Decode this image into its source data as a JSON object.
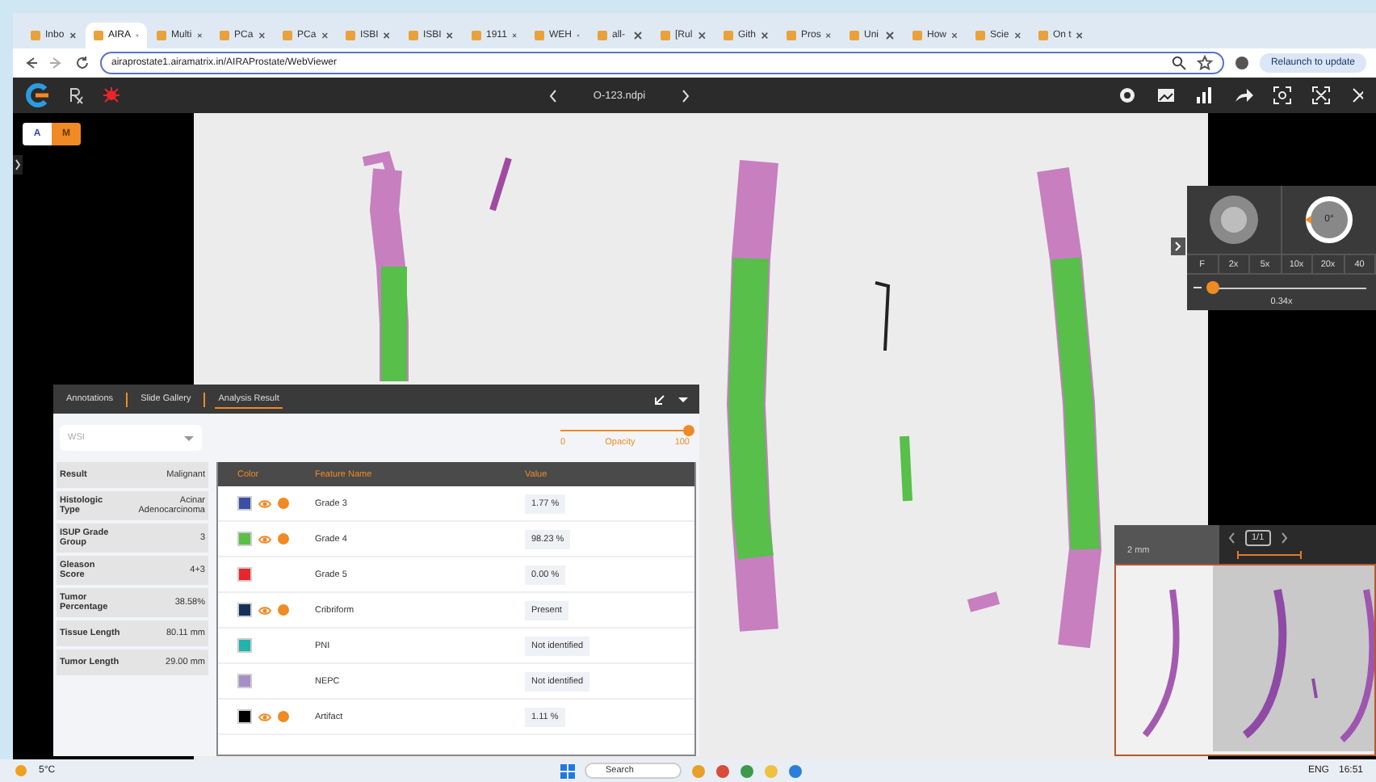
{
  "browser": {
    "tabs": [
      {
        "label": "Inbo",
        "selected": false
      },
      {
        "label": "AIRA",
        "selected": true
      },
      {
        "label": "Multi",
        "selected": false
      },
      {
        "label": "PCa",
        "selected": false
      },
      {
        "label": "PCa",
        "selected": false
      },
      {
        "label": "ISBI",
        "selected": false
      },
      {
        "label": "ISBI",
        "selected": false
      },
      {
        "label": "1911",
        "selected": false
      },
      {
        "label": "WEH",
        "selected": false
      },
      {
        "label": "all-",
        "selected": false
      },
      {
        "label": "[Rul",
        "selected": false
      },
      {
        "label": "Gith",
        "selected": false
      },
      {
        "label": "Pros",
        "selected": false
      },
      {
        "label": "Uni",
        "selected": false
      },
      {
        "label": "How",
        "selected": false
      },
      {
        "label": "Scie",
        "selected": false
      },
      {
        "label": "On t",
        "selected": false
      }
    ],
    "url": "airaprostate1.airamatrix.in/AIRAProstate/WebViewer",
    "update_button": "Relaunch to update"
  },
  "toolbar": {
    "file_name": "O-123.ndpi"
  },
  "mode_toggle": [
    {
      "label": "A",
      "selected": false
    },
    {
      "label": "M",
      "selected": true
    }
  ],
  "panel": {
    "tabs": [
      {
        "label": "Annotations",
        "selected": false
      },
      {
        "label": "Slide Gallery",
        "selected": false
      },
      {
        "label": "Analysis Result",
        "selected": true
      }
    ],
    "scope_select": {
      "value": "WSI"
    },
    "opacity": {
      "min": "0",
      "label": "Opacity",
      "max": "100",
      "level": 1
    },
    "summary": [
      {
        "label": "Result",
        "value": "Malignant"
      },
      {
        "label": "Histologic Type",
        "value": "Acinar Adenocarcinoma"
      },
      {
        "label": "ISUP Grade Group",
        "value": "3"
      },
      {
        "label": "Gleason Score",
        "value": "4+3"
      },
      {
        "label": "Tumor Percentage",
        "value": "38.58%"
      },
      {
        "label": "Tissue Length",
        "value": "80.11 mm"
      },
      {
        "label": "Tumor Length",
        "value": "29.00 mm"
      }
    ],
    "table": {
      "columns": [
        "Color",
        "Feature Name",
        "Value"
      ],
      "rows": [
        {
          "color": "#3b4fa6",
          "visible": true,
          "feature": "Grade 3",
          "value": "1.77 %"
        },
        {
          "color": "#5cbf45",
          "visible": true,
          "feature": "Grade 4",
          "value": "98.23 %"
        },
        {
          "color": "#e8262a",
          "visible": false,
          "feature": "Grade 5",
          "value": "0.00 %"
        },
        {
          "color": "#15305a",
          "visible": true,
          "feature": "Cribriform",
          "value": "Present"
        },
        {
          "color": "#21b3ad",
          "visible": false,
          "feature": "PNI",
          "value": "Not identified"
        },
        {
          "color": "#a68fc9",
          "visible": false,
          "feature": "NEPC",
          "value": "Not identified"
        },
        {
          "color": "#000000",
          "visible": true,
          "feature": "Artifact",
          "value": "1.11 %"
        }
      ]
    }
  },
  "zoom_widget": {
    "rotation": "0°",
    "magnifications": [
      "F",
      "2x",
      "5x",
      "10x",
      "20x",
      "40"
    ],
    "level": 0.03,
    "reading": "0.34x"
  },
  "minimap": {
    "page": "1/1",
    "scale": "2 mm"
  },
  "taskbar": {
    "weather": "5°C",
    "search_placeholder": "Search",
    "language": "ENG",
    "time": "16:51"
  }
}
